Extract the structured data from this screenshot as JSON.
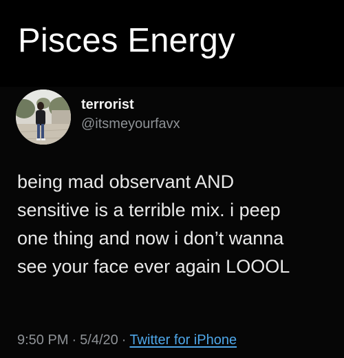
{
  "banner": {
    "title": "Pisces Energy"
  },
  "tweet": {
    "display_name": "terrorist",
    "handle": "@itsmeyourfavx",
    "text_lines": [
      "being mad observant AND",
      "sensitive is a terrible mix. i peep",
      "one thing and now i don’t wanna",
      "see your face ever again LOOOL"
    ],
    "time": "9:50 PM",
    "date": "5/4/20",
    "separator": "·",
    "source": "Twitter for iPhone"
  },
  "colors": {
    "background": "#000000",
    "text_primary": "#e9e9e9",
    "text_secondary": "#8e9296",
    "link": "#4ea6e8"
  }
}
